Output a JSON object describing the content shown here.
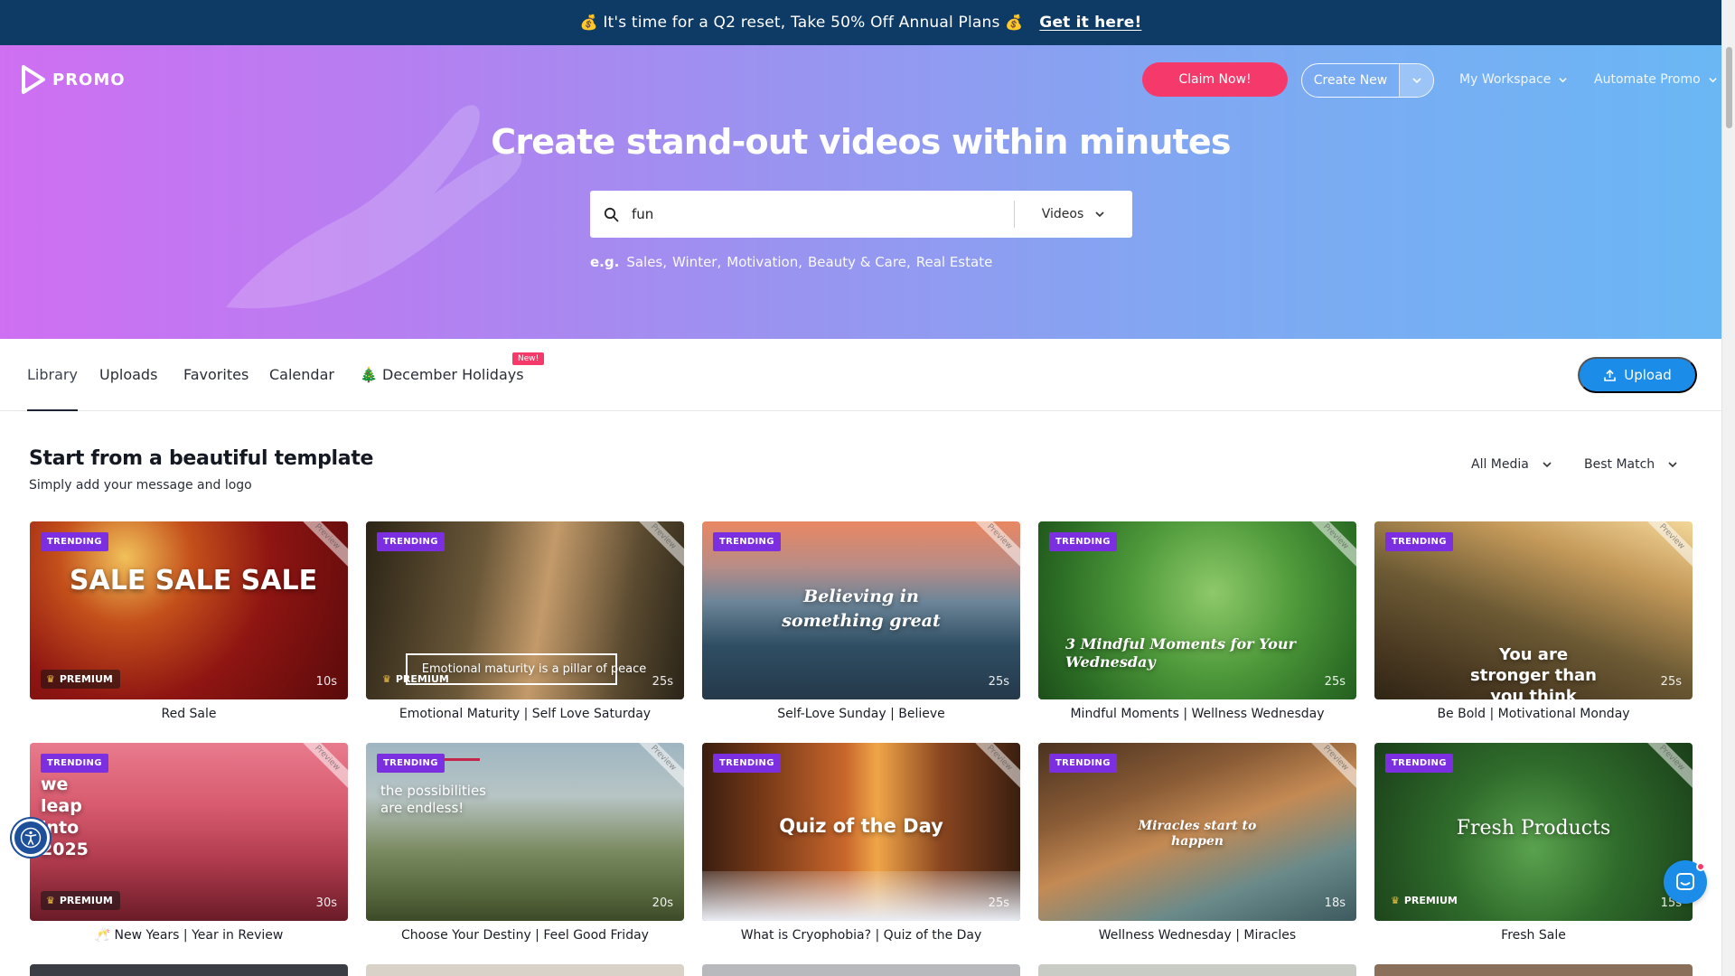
{
  "promo": {
    "emoji_left": "💰",
    "text": "It's time for a Q2 reset, Take 50% Off Annual Plans",
    "emoji_right": "💰",
    "link": "Get it here!"
  },
  "header": {
    "logo": "PROMO",
    "claim": "Claim Now!",
    "create": "Create New",
    "workspace": "My Workspace",
    "automate": "Automate Promo"
  },
  "hero": {
    "title": "Create stand-out videos within minutes",
    "search_value": "fun",
    "search_type": "Videos",
    "eg_label": "e.g.",
    "examples": [
      "Sales,",
      "Winter,",
      "Motivation,",
      "Beauty & Care,",
      "Real Estate"
    ]
  },
  "tabs": {
    "items": [
      "Library",
      "Uploads",
      "Favorites",
      "Calendar",
      "December Holidays"
    ],
    "holiday_icon": "🎄",
    "new_badge": "New!",
    "upload": "Upload"
  },
  "section": {
    "title": "Start from a beautiful template",
    "subtitle": "Simply add your message and logo",
    "filter_media": "All Media",
    "filter_sort": "Best Match"
  },
  "labels": {
    "trending": "TRENDING",
    "premium": "PREMIUM",
    "preview": "Preview"
  },
  "cards": [
    {
      "title": "Red Sale",
      "duration": "10s",
      "premium": true,
      "overlay": "SALE SALE SALE"
    },
    {
      "title": "Emotional Maturity | Self Love Saturday",
      "duration": "25s",
      "premium": true,
      "overlay": "Emotional maturity is a pillar of peace"
    },
    {
      "title": "Self-Love Sunday | Believe",
      "duration": "25s",
      "premium": false,
      "overlay": "Believing in something great"
    },
    {
      "title": "Mindful Moments | Wellness Wednesday",
      "duration": "25s",
      "premium": false,
      "overlay": "3 Mindful Moments for Your Wednesday"
    },
    {
      "title": "Be Bold | Motivational Monday",
      "duration": "25s",
      "premium": false,
      "overlay": "You are stronger than you think"
    },
    {
      "title": "🥂 New Years | Year in Review",
      "duration": "30s",
      "premium": true,
      "overlay": "we leap into 2025"
    },
    {
      "title": "Choose Your Destiny | Feel Good Friday",
      "duration": "20s",
      "premium": false,
      "overlay": "the possibilities are endless!"
    },
    {
      "title": "What is Cryophobia? | Quiz of the Day",
      "duration": "25s",
      "premium": false,
      "overlay": "Quiz of the Day"
    },
    {
      "title": "Wellness Wednesday | Miracles",
      "duration": "18s",
      "premium": false,
      "overlay": "Miracles start to happen"
    },
    {
      "title": "Fresh Sale",
      "duration": "15s",
      "premium": true,
      "overlay": "Fresh Products"
    }
  ],
  "colors": {
    "promo_bar": "#0e3a66",
    "claim": "#f5396a",
    "upload": "#1b8ce8",
    "trending": "#7b2fe0"
  }
}
